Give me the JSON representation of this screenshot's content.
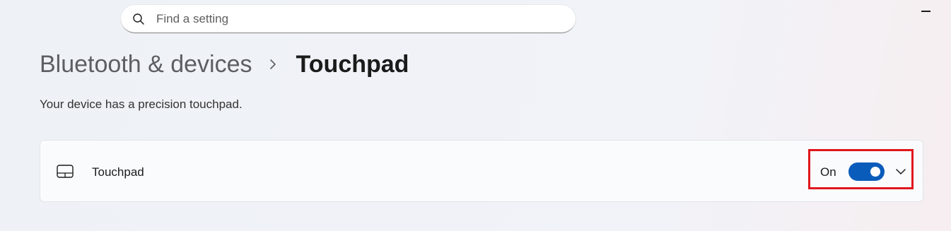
{
  "search": {
    "placeholder": "Find a setting",
    "icon": "search-icon"
  },
  "window": {
    "minimize_icon": "minimize-icon"
  },
  "breadcrumb": {
    "parent": "Bluetooth & devices",
    "separator_icon": "chevron-right-icon",
    "current": "Touchpad"
  },
  "description": "Your device has a precision touchpad.",
  "touchpad_setting": {
    "icon": "touchpad-icon",
    "label": "Touchpad",
    "state_label": "On",
    "toggle_on": true,
    "expand_icon": "chevron-down-icon"
  },
  "colors": {
    "accent": "#0a5cba",
    "highlight": "#e0171c"
  }
}
